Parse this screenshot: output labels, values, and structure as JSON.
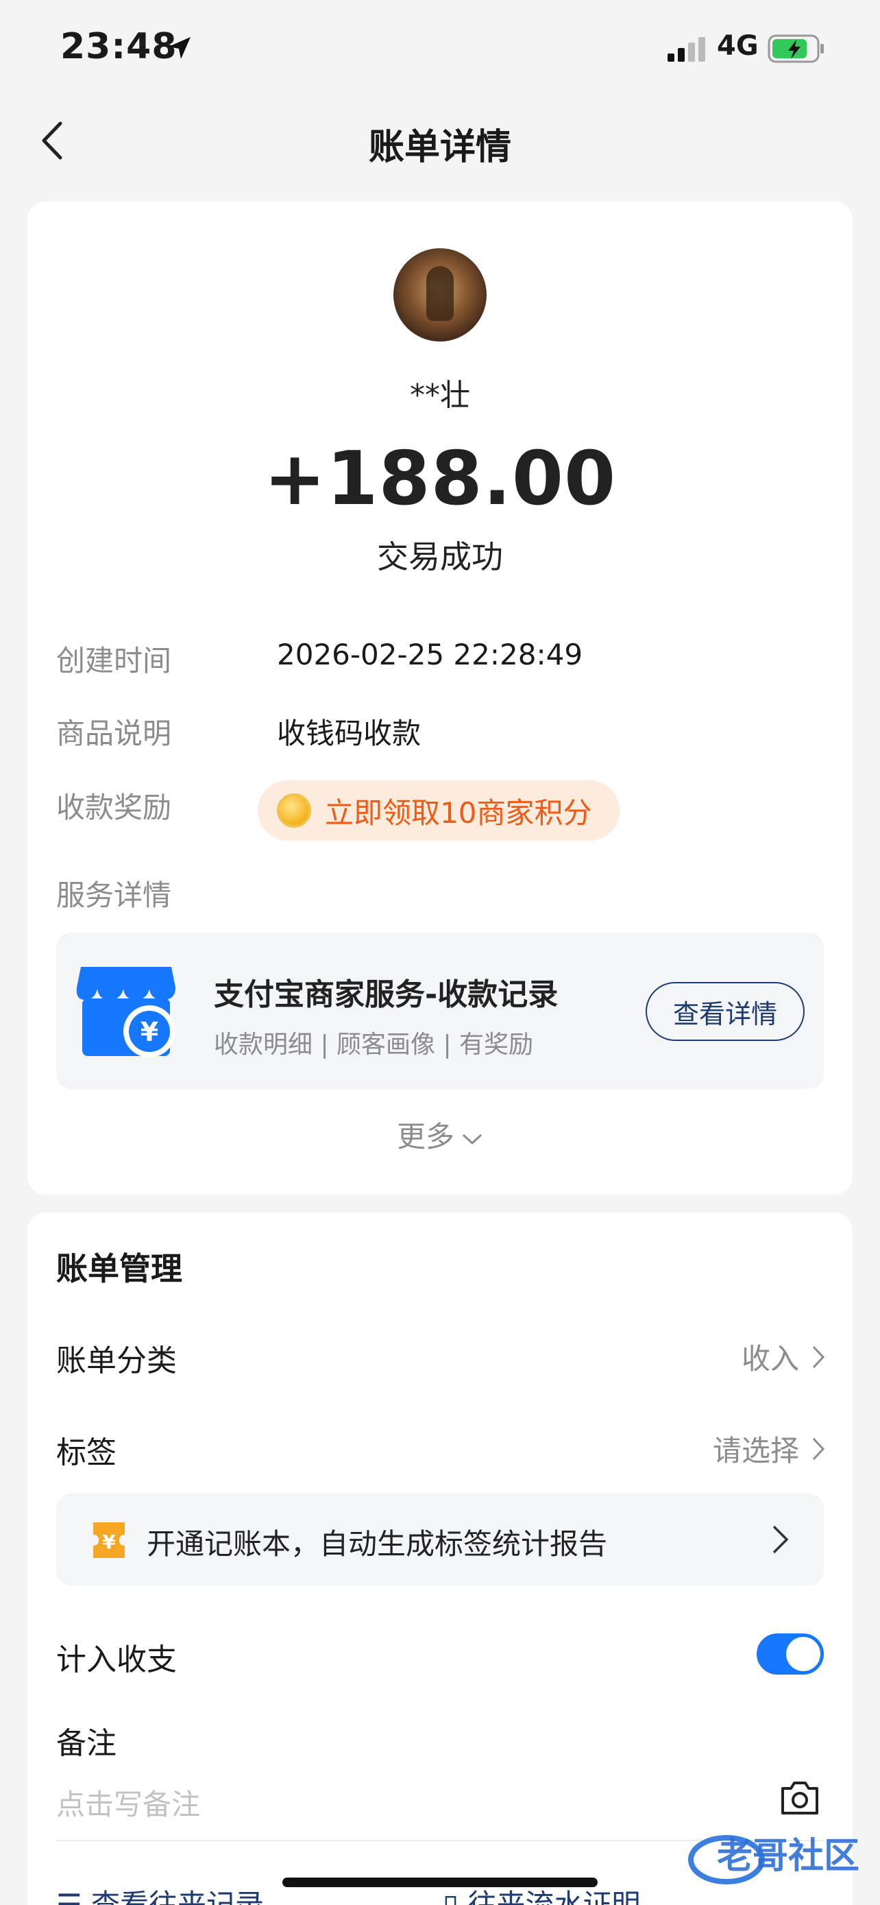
{
  "status_bar": {
    "time": "23:48",
    "network": "4G"
  },
  "nav": {
    "title": "账单详情"
  },
  "transaction": {
    "payer": "**壮",
    "amount": "+188.00",
    "status": "交易成功"
  },
  "details": {
    "created_label": "创建时间",
    "created_value": "2026-02-25 22:28:49",
    "item_label": "商品说明",
    "item_value": "收钱码收款",
    "reward_label": "收款奖励",
    "reward_text": "立即领取10商家积分",
    "service_label": "服务详情"
  },
  "service": {
    "title": "支付宝商家服务-收款记录",
    "subtitle": "收款明细 | 顾客画像 | 有奖励",
    "button": "查看详情"
  },
  "more_label": "更多",
  "management": {
    "title": "账单管理",
    "category_label": "账单分类",
    "category_value": "收入",
    "tag_label": "标签",
    "tag_value": "请选择",
    "promo_text": "开通记账本，自动生成标签统计报告",
    "include_label": "计入收支",
    "include_on": true,
    "note_label": "备注",
    "note_placeholder": "点击写备注"
  },
  "bottom": {
    "link1": "查看往来记录",
    "link2": "往来流水证明"
  },
  "watermark": "老哥社区",
  "colors": {
    "accent": "#1677ff",
    "reward": "#f05a14",
    "link": "#1f3a6e"
  }
}
